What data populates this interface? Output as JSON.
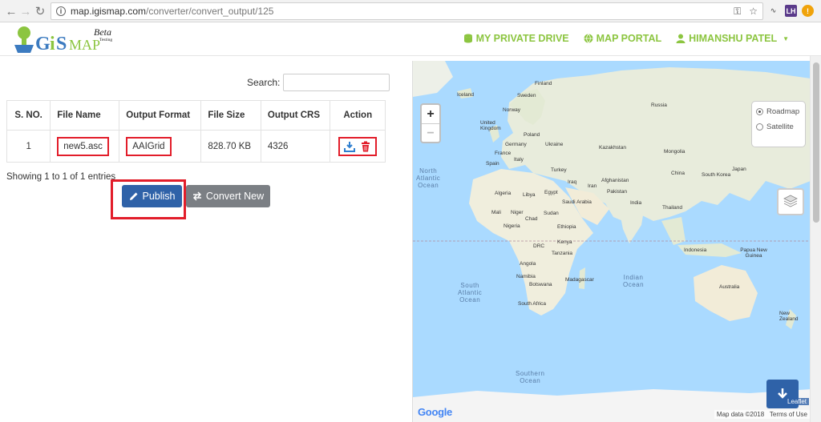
{
  "browser": {
    "url_host": "map.igismap.com",
    "url_path": "/converter/convert_output/125",
    "back_icon": "back-arrow-icon",
    "forward_icon": "forward-arrow-icon",
    "reload_icon": "reload-icon",
    "ext_label": "LH"
  },
  "header": {
    "logo_text": "GiSMAP",
    "beta": "Beta",
    "testing": "Testing",
    "nav": [
      {
        "label": "MY PRIVATE DRIVE",
        "icon": "database-icon"
      },
      {
        "label": "MAP PORTAL",
        "icon": "globe-icon"
      },
      {
        "label": "HIMANSHU PATEL",
        "icon": "user-icon"
      }
    ],
    "accent": "#8cc540"
  },
  "table": {
    "search_label": "Search:",
    "search_value": "",
    "columns": [
      "S. NO.",
      "File Name",
      "Output Format",
      "File Size",
      "Output CRS",
      "Action"
    ],
    "rows": [
      {
        "sno": "1",
        "file_name": "new5.asc",
        "format": "AAIGrid",
        "size": "828.70 KB",
        "crs": "4326"
      }
    ],
    "entries_text": "Showing 1 to 1 of 1 entries"
  },
  "buttons": {
    "publish": "Publish",
    "convert_new": "Convert New",
    "publish_color": "#2f62a8",
    "convert_color": "#7b7f84",
    "highlight_color": "#e21d2a"
  },
  "map": {
    "zoom_in": "+",
    "zoom_out": "−",
    "layer_options": [
      "Roadmap",
      "Satellite"
    ],
    "selected_layer": "Roadmap",
    "attribution": "Map data ©2018",
    "terms": "Terms of Use",
    "leaflet": "Leaflet",
    "google": "Google",
    "oceans": [
      {
        "name": "North Atlantic Ocean",
        "lines": [
          "North",
          "Atlantic",
          "Ocean"
        ]
      },
      {
        "name": "South Atlantic Ocean",
        "lines": [
          "South",
          "Atlantic",
          "Ocean"
        ]
      },
      {
        "name": "Indian Ocean",
        "lines": [
          "Indian",
          "Ocean"
        ]
      },
      {
        "name": "Southern Ocean",
        "lines": [
          "Southern",
          "Ocean"
        ]
      }
    ],
    "countries": [
      "Finland",
      "Iceland",
      "Sweden",
      "Norway",
      "Russia",
      "United Kingdom",
      "Poland",
      "Germany",
      "Ukraine",
      "France",
      "Kazakhstan",
      "Mongolia",
      "Spain",
      "Italy",
      "Turkey",
      "China",
      "South Korea",
      "Japan",
      "Iraq",
      "Iran",
      "Afghanistan",
      "Pakistan",
      "Algeria",
      "Libya",
      "Egypt",
      "Saudi Arabia",
      "India",
      "Thailand",
      "Mali",
      "Niger",
      "Chad",
      "Sudan",
      "Nigeria",
      "Ethiopia",
      "Kenya",
      "DRC",
      "Tanzania",
      "Indonesia",
      "Papua New Guinea",
      "Angola",
      "Namibia",
      "Botswana",
      "Madagascar",
      "South Africa",
      "Australia",
      "New Zealand"
    ]
  }
}
